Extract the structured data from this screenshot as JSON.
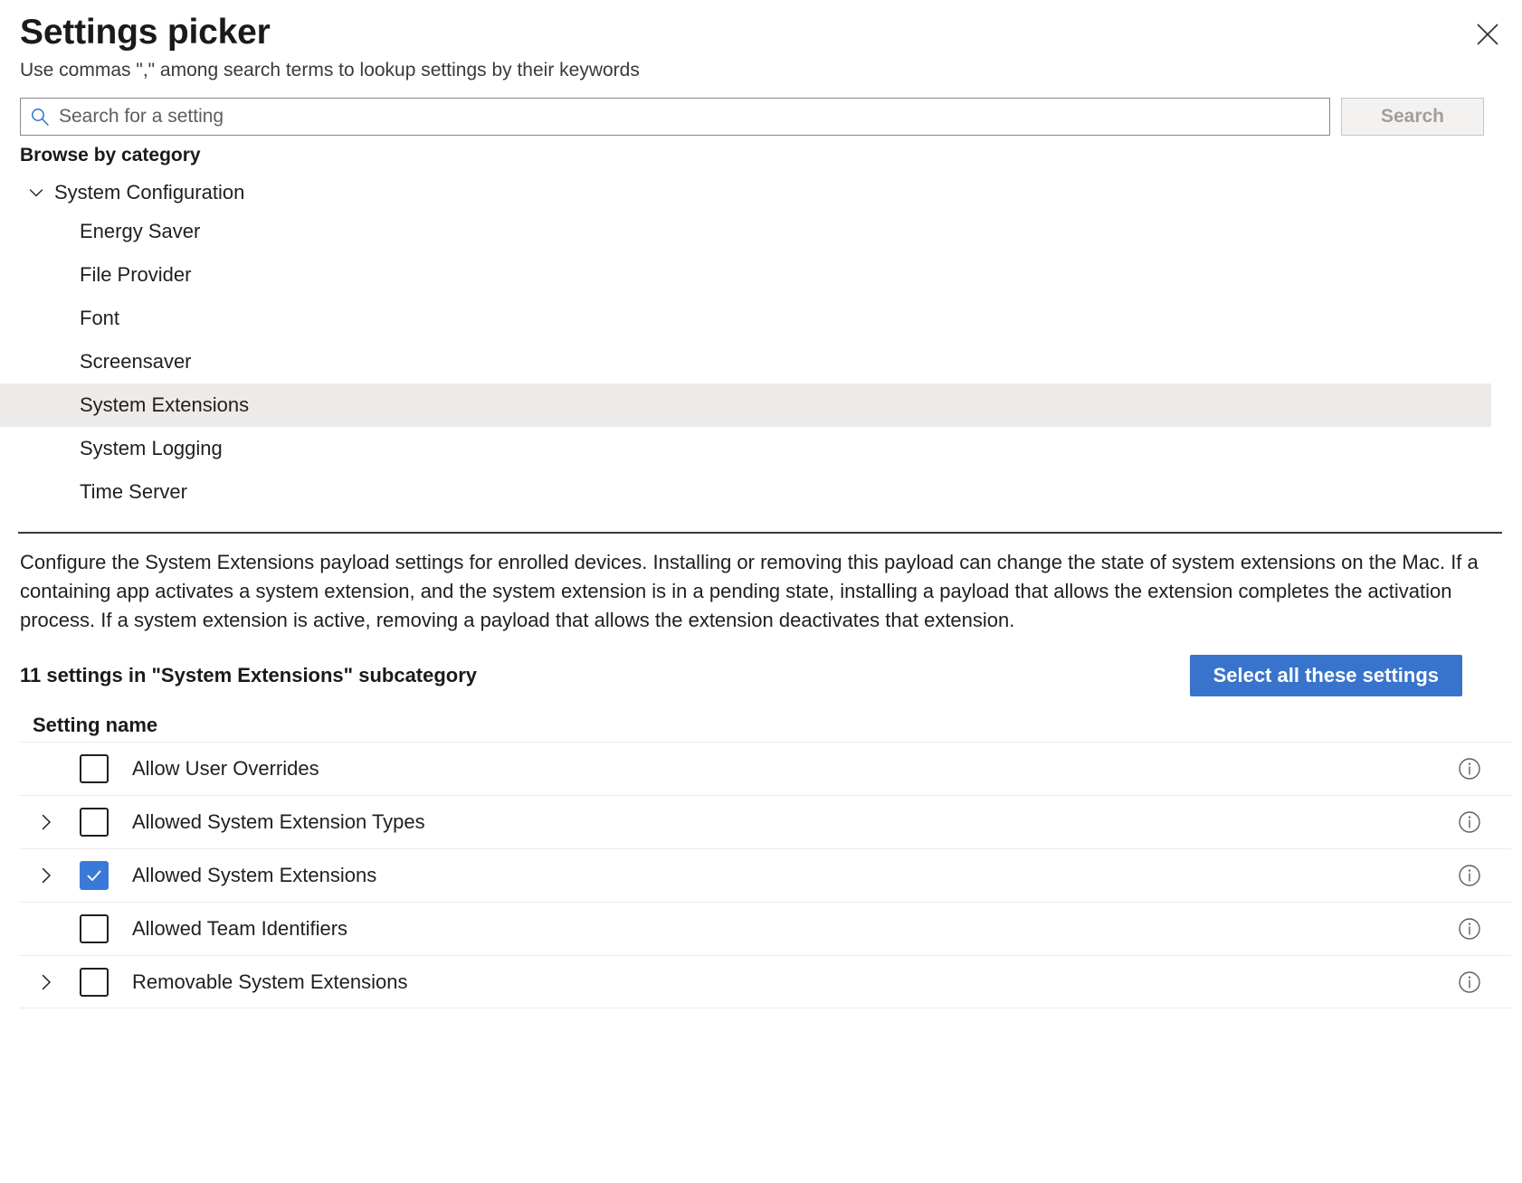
{
  "header": {
    "title": "Settings picker",
    "subtitle": "Use commas \",\" among search terms to lookup settings by their keywords",
    "close_icon": "close-icon"
  },
  "search": {
    "placeholder": "Search for a setting",
    "value": "",
    "button_label": "Search",
    "icon": "search-icon"
  },
  "browse": {
    "label": "Browse by category",
    "group": {
      "label": "System Configuration",
      "expanded": true,
      "chevron_icon": "chevron-down-icon"
    },
    "items": [
      {
        "label": "Energy Saver",
        "selected": false
      },
      {
        "label": "File Provider",
        "selected": false
      },
      {
        "label": "Font",
        "selected": false
      },
      {
        "label": "Screensaver",
        "selected": false
      },
      {
        "label": "System Extensions",
        "selected": true
      },
      {
        "label": "System Logging",
        "selected": false
      },
      {
        "label": "Time Server",
        "selected": false
      }
    ]
  },
  "description": "Configure the System Extensions payload settings for enrolled devices. Installing or removing this payload can change the state of system extensions on the Mac. If a containing app activates a system extension, and the system extension is in a pending state, installing a payload that allows the extension completes the activation process. If a system extension is active, removing a payload that allows the extension deactivates that extension.",
  "settings_summary": {
    "count_text": "11 settings in \"System Extensions\" subcategory",
    "select_all_label": "Select all these settings"
  },
  "table": {
    "column_header": "Setting name",
    "rows": [
      {
        "label": "Allow User Overrides",
        "checked": false,
        "expandable": false,
        "info_icon": "info-icon"
      },
      {
        "label": "Allowed System Extension Types",
        "checked": false,
        "expandable": true,
        "info_icon": "info-icon"
      },
      {
        "label": "Allowed System Extensions",
        "checked": true,
        "expandable": true,
        "info_icon": "info-icon"
      },
      {
        "label": "Allowed Team Identifiers",
        "checked": false,
        "expandable": false,
        "info_icon": "info-icon"
      },
      {
        "label": "Removable System Extensions",
        "checked": false,
        "expandable": true,
        "info_icon": "info-icon"
      }
    ]
  },
  "colors": {
    "accent_blue": "#3874cb",
    "checkbox_blue": "#3b79d6",
    "row_selected_gray": "#edebe9",
    "border_gray": "#8a8886",
    "text_primary": "#201f1e",
    "text_secondary": "#605e5c"
  }
}
